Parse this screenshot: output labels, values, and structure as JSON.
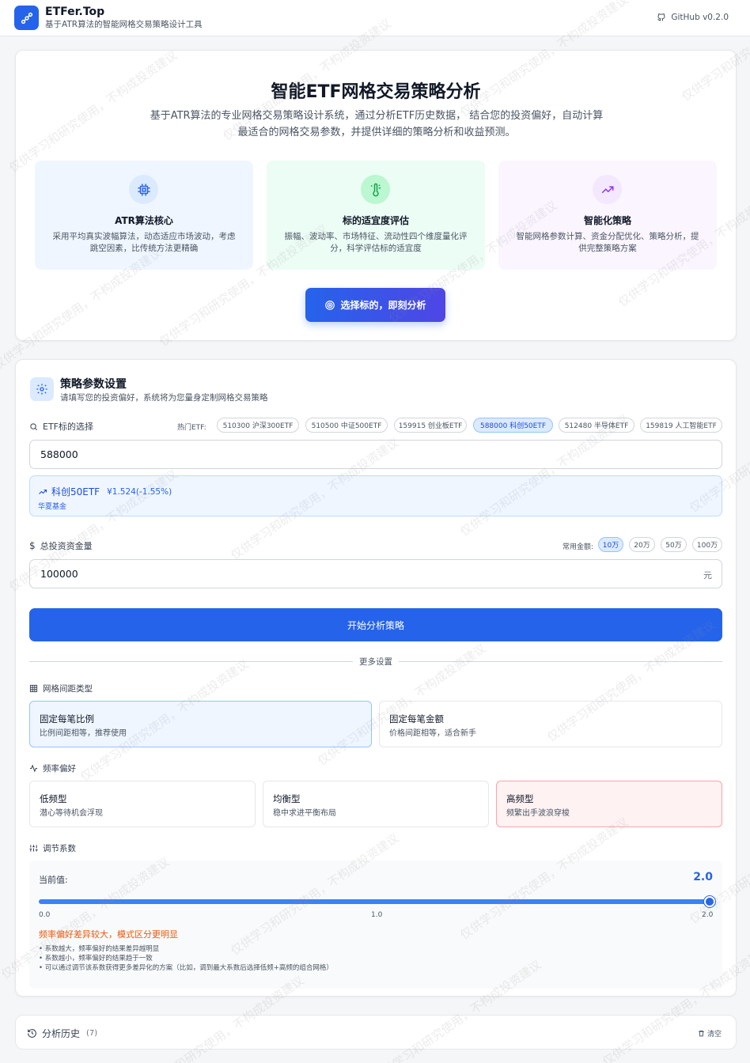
{
  "app": {
    "name": "ETFer.Top",
    "subtitle": "基于ATR算法的智能网格交易策略设计工具",
    "github": "GitHub v0.2.0",
    "watermark": "仅供学习和研究使用，不构成投资建议"
  },
  "hero": {
    "title": "智能ETF网格交易策略分析",
    "description": "基于ATR算法的专业网格交易策略设计系统，通过分析ETF历史数据， 结合您的投资偏好，自动计算最适合的网格交易参数，并提供详细的策略分析和收益预测。",
    "features": [
      {
        "title": "ATR算法核心",
        "desc": "采用平均真实波幅算法，动态适应市场波动，考虑跳空因素，比传统方法更精确",
        "icon": "cpu-icon",
        "bg": "#eff6ff",
        "iconBg": "#dbeafe",
        "iconColor": "#2563eb"
      },
      {
        "title": "标的适宜度评估",
        "desc": "振幅、波动率、市场特征、流动性四个维度量化评分，科学评估标的适宜度",
        "icon": "thermometer-icon",
        "bg": "#ecfdf5",
        "iconBg": "#bbf7d0",
        "iconColor": "#16a34a"
      },
      {
        "title": "智能化策略",
        "desc": "智能网格参数计算、资金分配优化、策略分析，提供完整策略方案",
        "icon": "trending-up-icon",
        "bg": "#faf5ff",
        "iconBg": "#f3e8ff",
        "iconColor": "#9333ea"
      }
    ],
    "cta_label": "选择标的，即刻分析"
  },
  "params": {
    "title": "策略参数设置",
    "subtitle": "请填写您的投资偏好，系统将为您量身定制网格交易策略",
    "etf_label": "ETF标的选择",
    "hot_label": "热门ETF:",
    "hot_etfs": [
      "510300 沪深300ETF",
      "510500 中证500ETF",
      "159915 创业板ETF",
      "588000 科创50ETF",
      "512480 半导体ETF",
      "159819 人工智能ETF"
    ],
    "hot_active_index": 3,
    "etf_input_value": "588000",
    "etf_info": {
      "name": "科创50ETF",
      "price": "¥1.524(-1.55%)",
      "fund": "华夏基金"
    },
    "capital_label": "总投资资金量",
    "common_label": "常用金额:",
    "amounts": [
      "10万",
      "20万",
      "50万",
      "100万"
    ],
    "amount_active_index": 0,
    "capital_value": "100000",
    "unit": "元",
    "start_label": "开始分析策略",
    "more_label": "更多设置",
    "grid_type_label": "网格间距类型",
    "grid_types": [
      {
        "title": "固定每笔比例",
        "desc": "比例间距相等，推荐使用"
      },
      {
        "title": "固定每笔金额",
        "desc": "价格间距相等，适合新手"
      }
    ],
    "freq_label": "频率偏好",
    "freqs": [
      {
        "title": "低频型",
        "desc": "潜心等待机会浮现"
      },
      {
        "title": "均衡型",
        "desc": "稳中求进平衡布局"
      },
      {
        "title": "高频型",
        "desc": "频繁出手波浪穿梭"
      }
    ],
    "coef_label": "调节系数",
    "current_label": "当前值:",
    "current_value": "2.0",
    "slider": {
      "min": 0.0,
      "max": 2.0,
      "value": 2.0
    },
    "ticks": [
      "0.0",
      "1.0",
      "2.0"
    ],
    "warning": "频率偏好差异较大，模式区分更明显",
    "notes": [
      "系数越大，频率偏好的结果差异越明显",
      "系数越小，频率偏好的结果趋于一致",
      "可以通过调节该系数获得更多差异化的方案（比如，调到最大系数后选择低频+高频的组合网格）"
    ]
  },
  "history": {
    "title": "分析历史",
    "count": "(7)",
    "clear": "清空"
  }
}
